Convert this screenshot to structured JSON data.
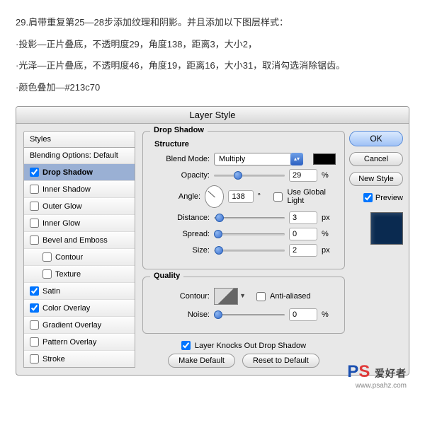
{
  "article": {
    "p1": "29.肩带重复第25—28步添加纹理和阴影。并且添加以下图层样式：",
    "p2": "·投影—正片叠底，不透明度29，角度138，距离3，大小2，",
    "p3": "·光泽—正片叠底，不透明度46，角度19，距离16，大小31，取消勾选消除锯齿。",
    "p4": "·颜色叠加—#213c70"
  },
  "dialog": {
    "title": "Layer Style",
    "styles_header": "Styles",
    "blending_label": "Blending Options: Default",
    "styles": [
      {
        "label": "Drop Shadow",
        "checked": true,
        "selected": true,
        "sub": false
      },
      {
        "label": "Inner Shadow",
        "checked": false,
        "selected": false,
        "sub": false
      },
      {
        "label": "Outer Glow",
        "checked": false,
        "selected": false,
        "sub": false
      },
      {
        "label": "Inner Glow",
        "checked": false,
        "selected": false,
        "sub": false
      },
      {
        "label": "Bevel and Emboss",
        "checked": false,
        "selected": false,
        "sub": false
      },
      {
        "label": "Contour",
        "checked": false,
        "selected": false,
        "sub": true
      },
      {
        "label": "Texture",
        "checked": false,
        "selected": false,
        "sub": true
      },
      {
        "label": "Satin",
        "checked": true,
        "selected": false,
        "sub": false
      },
      {
        "label": "Color Overlay",
        "checked": true,
        "selected": false,
        "sub": false
      },
      {
        "label": "Gradient Overlay",
        "checked": false,
        "selected": false,
        "sub": false
      },
      {
        "label": "Pattern Overlay",
        "checked": false,
        "selected": false,
        "sub": false
      },
      {
        "label": "Stroke",
        "checked": false,
        "selected": false,
        "sub": false
      }
    ],
    "group_title": "Drop Shadow",
    "structure_title": "Structure",
    "quality_title": "Quality",
    "labels": {
      "blend_mode": "Blend Mode:",
      "opacity": "Opacity:",
      "angle": "Angle:",
      "distance": "Distance:",
      "spread": "Spread:",
      "size": "Size:",
      "contour": "Contour:",
      "noise": "Noise:",
      "use_global": "Use Global Light",
      "anti_aliased": "Anti-aliased",
      "knock_out": "Layer Knocks Out Drop Shadow",
      "make_default": "Make Default",
      "reset_default": "Reset to Default"
    },
    "values": {
      "blend_mode": "Multiply",
      "opacity": "29",
      "angle": "138",
      "distance": "3",
      "spread": "0",
      "size": "2",
      "noise": "0",
      "pct": "%",
      "deg": "°",
      "px": "px",
      "swatch_color": "#000000"
    },
    "buttons": {
      "ok": "OK",
      "cancel": "Cancel",
      "new_style": "New Style",
      "preview": "Preview"
    },
    "checks": {
      "use_global": false,
      "anti_aliased": false,
      "knock_out": true,
      "preview": true
    }
  },
  "watermark": {
    "p": "PS",
    "zh": "爱好者",
    "url": "www.psahz.com"
  }
}
